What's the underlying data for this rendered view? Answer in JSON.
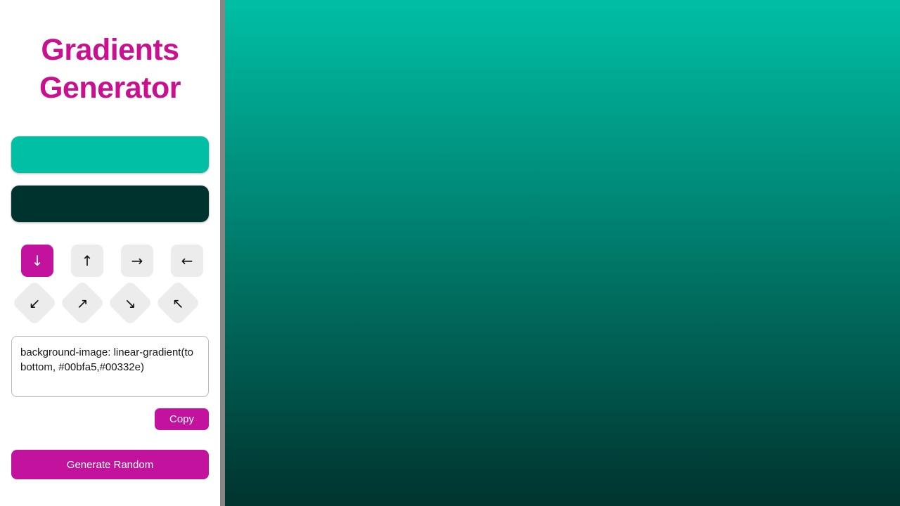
{
  "app": {
    "title_line_1": "Gradients",
    "title_line_2": "Generator",
    "title_color": "#c9108f",
    "accent_color": "#c2129e",
    "panel_background": "#ffffff"
  },
  "colors": {
    "start": "#00bfa5",
    "end": "#00332e",
    "start_swatch_name": "color-start",
    "end_swatch_name": "color-end"
  },
  "directions": {
    "selected": "to bottom",
    "straight": [
      {
        "label": "↓",
        "icon": "arrow-down-icon",
        "value": "to bottom",
        "active": true
      },
      {
        "label": "↑",
        "icon": "arrow-up-icon",
        "value": "to top",
        "active": false
      },
      {
        "label": "→",
        "icon": "arrow-right-icon",
        "value": "to right",
        "active": false
      },
      {
        "label": "←",
        "icon": "arrow-left-icon",
        "value": "to left",
        "active": false
      }
    ],
    "diagonal": [
      {
        "label": "↙",
        "icon": "arrow-down-left-icon",
        "value": "to bottom left",
        "active": false
      },
      {
        "label": "↗",
        "icon": "arrow-up-right-icon",
        "value": "to top right",
        "active": false
      },
      {
        "label": "↘",
        "icon": "arrow-down-right-icon",
        "value": "to bottom right",
        "active": false
      },
      {
        "label": "↖",
        "icon": "arrow-up-left-icon",
        "value": "to top left",
        "active": false
      }
    ]
  },
  "css_output": {
    "value": "background-image: linear-gradient(to bottom, #00bfa5,#00332e)",
    "placeholder": "background-image: linear-gradient(...)"
  },
  "buttons": {
    "copy_label": "Copy",
    "generate_label": "Generate Random"
  },
  "preview": {
    "gradient_css": "linear-gradient(to bottom, #00bfa5, #00332e)",
    "top_color": "#00bfa5",
    "bottom_color": "#00332e"
  },
  "scrollbar": {
    "track_color": "#f1f1f1",
    "thumb_color": "#868686"
  }
}
